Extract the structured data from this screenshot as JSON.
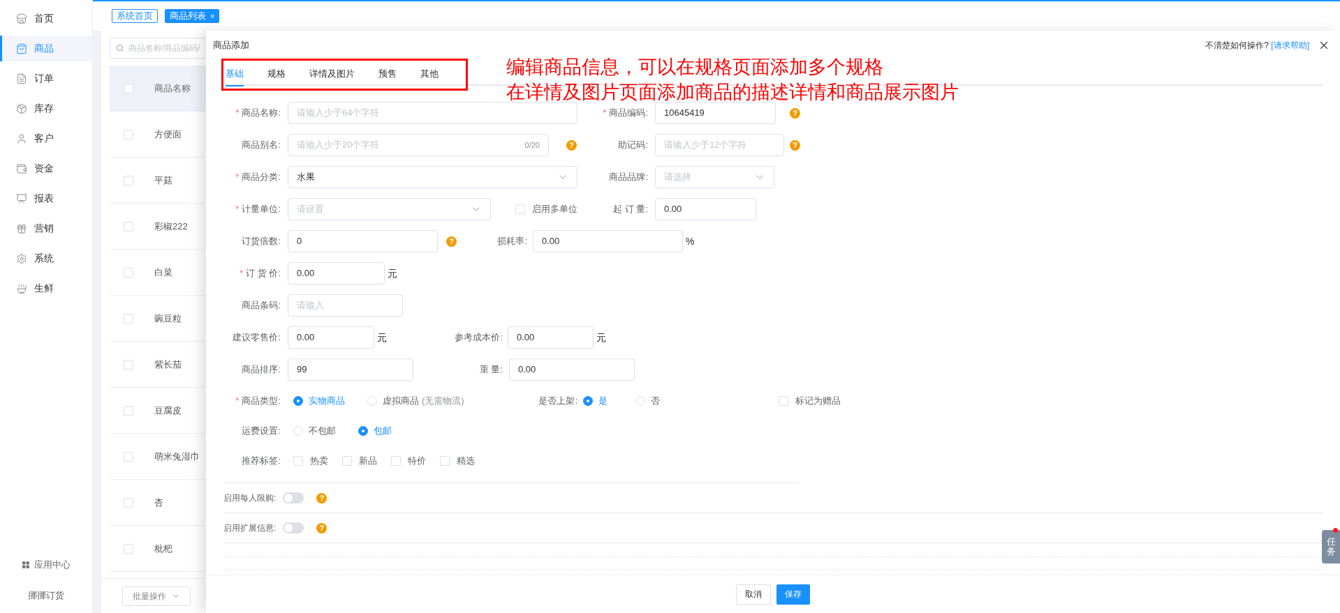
{
  "sidebar": {
    "items": [
      {
        "label": "首页",
        "selected": false
      },
      {
        "label": "商品",
        "selected": true
      },
      {
        "label": "订单",
        "selected": false
      },
      {
        "label": "库存",
        "selected": false
      },
      {
        "label": "客户",
        "selected": false
      },
      {
        "label": "资金",
        "selected": false
      },
      {
        "label": "报表",
        "selected": false
      },
      {
        "label": "营销",
        "selected": false
      },
      {
        "label": "系统",
        "selected": false
      },
      {
        "label": "生鲜",
        "selected": false
      }
    ],
    "app_center": "应用中心",
    "brand": "挪挪订货"
  },
  "top_tabs": [
    {
      "label": "系统首页",
      "selected": false
    },
    {
      "label": "商品列表",
      "selected": true,
      "close": "×"
    }
  ],
  "list": {
    "search_placeholder": "商品名称/商品编码/",
    "column": "商品名称",
    "header_checked": false,
    "rows": [
      {
        "name": "方便面",
        "checked": false
      },
      {
        "name": "平菇",
        "checked": false
      },
      {
        "name": "彩椒222",
        "checked": false
      },
      {
        "name": "白菜",
        "checked": false
      },
      {
        "name": "豌豆粒",
        "checked": false
      },
      {
        "name": "紫长茄",
        "checked": false
      },
      {
        "name": "豆腐皮",
        "checked": false
      },
      {
        "name": "萌米兔湿巾",
        "checked": false
      },
      {
        "name": "杏",
        "checked": false
      },
      {
        "name": "枇杷",
        "checked": false
      }
    ],
    "batch_button": "批量操作"
  },
  "drawer": {
    "title": "商品添加",
    "help_text": "不清楚如何操作?",
    "help_link": "[请求帮助]",
    "tabs": [
      {
        "label": "基础",
        "selected": true
      },
      {
        "label": "规格",
        "selected": false
      },
      {
        "label": "详情及图片",
        "selected": false
      },
      {
        "label": "预售",
        "selected": false
      },
      {
        "label": "其他",
        "selected": false
      }
    ],
    "annotation": [
      "编辑商品信息，可以在规格页面添加多个规格",
      "在详情及图片页面添加商品的描述详情和商品展示图片"
    ],
    "fields": {
      "name": {
        "label": "商品名称:",
        "required_mark": "*",
        "kind": "text",
        "placeholder": "请输入少于64个字符"
      },
      "code": {
        "label": "商品编码:",
        "required_mark": "*",
        "kind": "text",
        "value": "10645419",
        "help": "?"
      },
      "alias": {
        "label": "商品别名:",
        "kind": "text",
        "placeholder": "请输入少于20个字符",
        "counter": "0/20",
        "help": "?"
      },
      "mnemonic": {
        "label": "助记码:",
        "kind": "text",
        "placeholder": "请输入少于12个字符",
        "help": "?"
      },
      "category": {
        "label": "商品分类:",
        "required_mark": "*",
        "kind": "select",
        "value": "水果"
      },
      "brand": {
        "label": "商品品牌:",
        "kind": "select",
        "placeholder": "请选择"
      },
      "unit": {
        "label": "计量单位:",
        "required_mark": "*",
        "kind": "select",
        "placeholder": "请设置"
      },
      "multi_unit": {
        "label": "启用多单位",
        "checked": false
      },
      "min_order": {
        "label": "起 订 量:",
        "kind": "text",
        "value": "0.00"
      },
      "multiple": {
        "label": "订货倍数:",
        "kind": "text",
        "value": "0",
        "help": "?"
      },
      "loss_rate": {
        "label": "损耗率:",
        "kind": "text",
        "value": "0.00",
        "unit": "%"
      },
      "order_price": {
        "label": "订 货 价:",
        "required_mark": "*",
        "kind": "text",
        "value": "0.00",
        "unit": "元"
      },
      "barcode": {
        "label": "商品条码:",
        "kind": "text",
        "placeholder": "请输入"
      },
      "retail_price": {
        "label": "建议零售价:",
        "kind": "text",
        "value": "0.00",
        "unit": "元"
      },
      "cost_price": {
        "label": "参考成本价:",
        "kind": "text",
        "value": "0.00",
        "unit": "元"
      },
      "sort": {
        "label": "商品排序:",
        "kind": "text",
        "value": "99"
      },
      "weight": {
        "label": "重 量:",
        "kind": "text",
        "value": "0.00"
      },
      "product_type": {
        "label": "商品类型:",
        "required_mark": "*",
        "options": [
          {
            "label": "实物商品",
            "selected": true
          },
          {
            "label": "虚拟商品",
            "note": "(无需物流)",
            "selected": false
          }
        ]
      },
      "on_shelf": {
        "label": "是否上架:",
        "options": [
          {
            "label": "是",
            "selected": true
          },
          {
            "label": "否",
            "selected": false
          }
        ]
      },
      "gift": {
        "label": "标记为赠品",
        "checked": false
      },
      "shipping": {
        "label": "运费设置:",
        "options": [
          {
            "label": "不包邮",
            "selected": false
          },
          {
            "label": "包邮",
            "selected": true
          }
        ]
      },
      "tags": {
        "label": "推荐标签:",
        "options": [
          {
            "label": "热卖",
            "checked": false
          },
          {
            "label": "新品",
            "checked": false
          },
          {
            "label": "特价",
            "checked": false
          },
          {
            "label": "精选",
            "checked": false
          }
        ]
      },
      "purchase_limit": {
        "label": "启用每人限购:",
        "on": false,
        "help": "?"
      },
      "extended_info": {
        "label": "启用扩展信息:",
        "on": false,
        "help": "?"
      }
    },
    "buttons": {
      "cancel": "取消",
      "save": "保存"
    }
  },
  "task_button": {
    "label": "任务",
    "badge": true
  }
}
